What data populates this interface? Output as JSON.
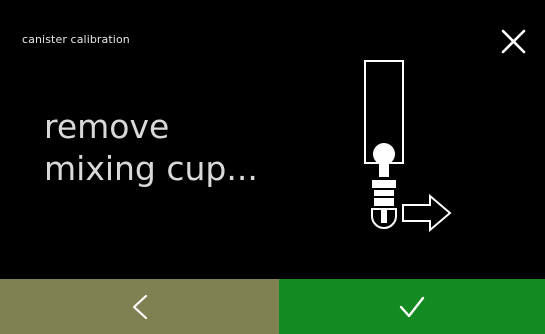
{
  "header": {
    "title": "canister calibration",
    "close_icon": "close-icon"
  },
  "main": {
    "instruction_line1": "remove",
    "instruction_line2": "mixing cup...",
    "illustration_icon": "remove-mixing-cup-illustration"
  },
  "footer": {
    "back_icon": "chevron-left-icon",
    "confirm_icon": "checkmark-icon",
    "back_color": "#7f8152",
    "confirm_color": "#138a22"
  }
}
